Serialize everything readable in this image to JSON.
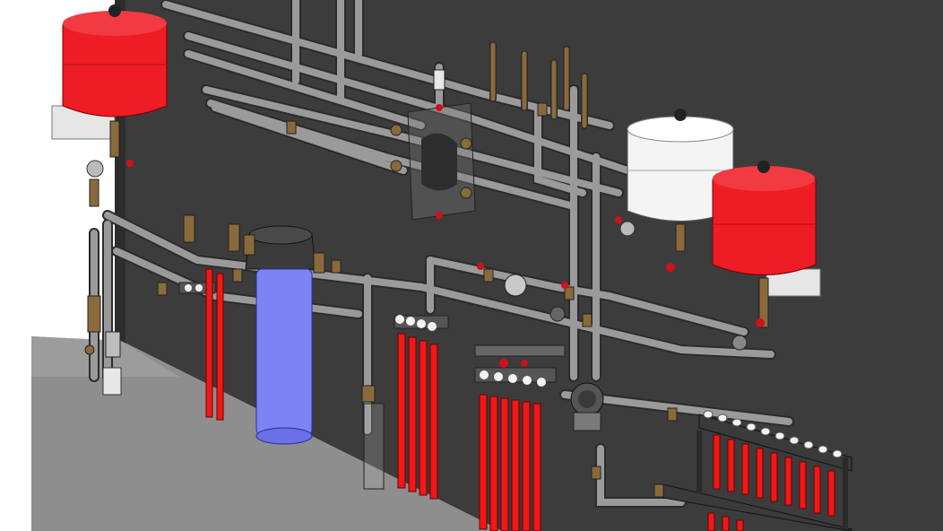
{
  "scene": {
    "description_visible_text": "",
    "colors": {
      "wall": "#3c3c3c",
      "wall_edge": "#2a2a2a",
      "floor": "#8c8c8c",
      "floor_light": "#a2a2a2",
      "background": "#ffffff",
      "pipe": "#9a9a9a",
      "pipe_dark": "#6e6e6e",
      "pipe_outline": "#2b2b2b",
      "red_tank": "#ee1c25",
      "white_tank": "#f4f4f4",
      "blue_filter": "#7d83f5",
      "filter_cap": "#3a3a3a",
      "brass": "#8a6a3a",
      "red_tube": "#f01818",
      "valve_red": "#d0101a",
      "bracket": "#e6e6e6"
    },
    "objects": [
      "expansion-tank-red-left",
      "expansion-tank-white",
      "expansion-tank-red-right",
      "water-filter-housing",
      "manifold-left-small",
      "manifold-center",
      "manifold-center-lower",
      "manifold-right",
      "circulator-pump",
      "pipework"
    ]
  }
}
